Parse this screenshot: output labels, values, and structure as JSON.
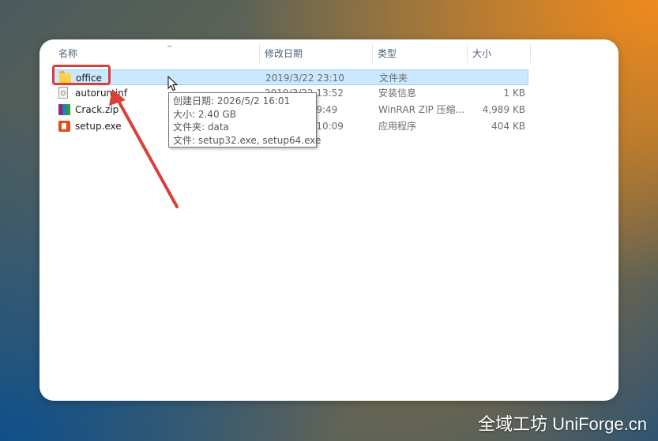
{
  "columns": {
    "name": "名称",
    "date": "修改日期",
    "type": "类型",
    "size": "大小"
  },
  "files": [
    {
      "icon": "folder-icon",
      "name": "office",
      "date": "2019/3/22 23:10",
      "type": "文件夹",
      "size": ""
    },
    {
      "icon": "inf-file-icon",
      "name": "autorun.inf",
      "date": "2019/3/22 13:52",
      "type": "安装信息",
      "size": "1 KB"
    },
    {
      "icon": "winrar-zip-icon",
      "name": "Crack.zip",
      "date": "2019/3/22 9:49",
      "type": "WinRAR ZIP 压缩...",
      "size": "4,989 KB"
    },
    {
      "icon": "office-setup-icon",
      "name": "setup.exe",
      "date": "2019/3/22 10:09",
      "type": "应用程序",
      "size": "404 KB"
    }
  ],
  "tooltip": {
    "created": "创建日期: 2026/5/2 16:01",
    "size": "大小: 2.40 GB",
    "folders": "文件夹: data",
    "files": "文件: setup32.exe, setup64.exe"
  },
  "watermark": "全域工坊 UniForge.cn",
  "colors": {
    "selection": "#cce8ff",
    "annotation": "#d9403a"
  }
}
